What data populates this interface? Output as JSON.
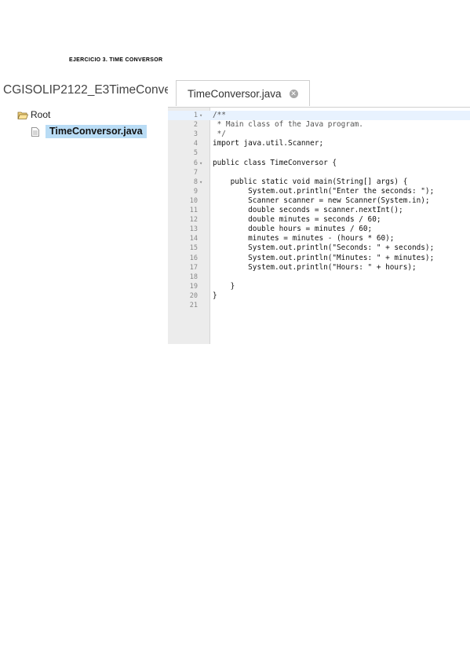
{
  "heading": "EJERCICIO 3. TIME CONVERSOR",
  "project": {
    "title": "CGISOLIP2122_E3TimeConve",
    "root_label": "Root",
    "file_label": "TimeConversor.java"
  },
  "editor": {
    "tab_label": "TimeConversor.java",
    "lines": [
      {
        "n": "1",
        "fold": "▾",
        "text": "/**"
      },
      {
        "n": "2",
        "fold": "",
        "text": " * Main class of the Java program."
      },
      {
        "n": "3",
        "fold": "",
        "text": " */"
      },
      {
        "n": "4",
        "fold": "",
        "text": "import java.util.Scanner;"
      },
      {
        "n": "5",
        "fold": "",
        "text": ""
      },
      {
        "n": "6",
        "fold": "▾",
        "text": "public class TimeConversor {"
      },
      {
        "n": "7",
        "fold": "",
        "text": ""
      },
      {
        "n": "8",
        "fold": "▾",
        "text": "    public static void main(String[] args) {"
      },
      {
        "n": "9",
        "fold": "",
        "text": "        System.out.println(\"Enter the seconds: \");"
      },
      {
        "n": "10",
        "fold": "",
        "text": "        Scanner scanner = new Scanner(System.in);"
      },
      {
        "n": "11",
        "fold": "",
        "text": "        double seconds = scanner.nextInt();"
      },
      {
        "n": "12",
        "fold": "",
        "text": "        double minutes = seconds / 60;"
      },
      {
        "n": "13",
        "fold": "",
        "text": "        double hours = minutes / 60;"
      },
      {
        "n": "14",
        "fold": "",
        "text": "        minutes = minutes - (hours * 60);"
      },
      {
        "n": "15",
        "fold": "",
        "text": "        System.out.println(\"Seconds: \" + seconds);"
      },
      {
        "n": "16",
        "fold": "",
        "text": "        System.out.println(\"Minutes: \" + minutes);"
      },
      {
        "n": "17",
        "fold": "",
        "text": "        System.out.println(\"Hours: \" + hours);"
      },
      {
        "n": "18",
        "fold": "",
        "text": ""
      },
      {
        "n": "19",
        "fold": "",
        "text": "    }"
      },
      {
        "n": "20",
        "fold": "",
        "text": "}"
      },
      {
        "n": "21",
        "fold": "",
        "text": ""
      }
    ]
  },
  "icons": {
    "folder": "folder-open-icon",
    "file": "java-file-icon",
    "close": "close-icon"
  },
  "colors": {
    "selected_file_bg": "#b9dcf5",
    "gutter_bg": "#ececec",
    "active_line_bg": "#e8f2fe"
  }
}
